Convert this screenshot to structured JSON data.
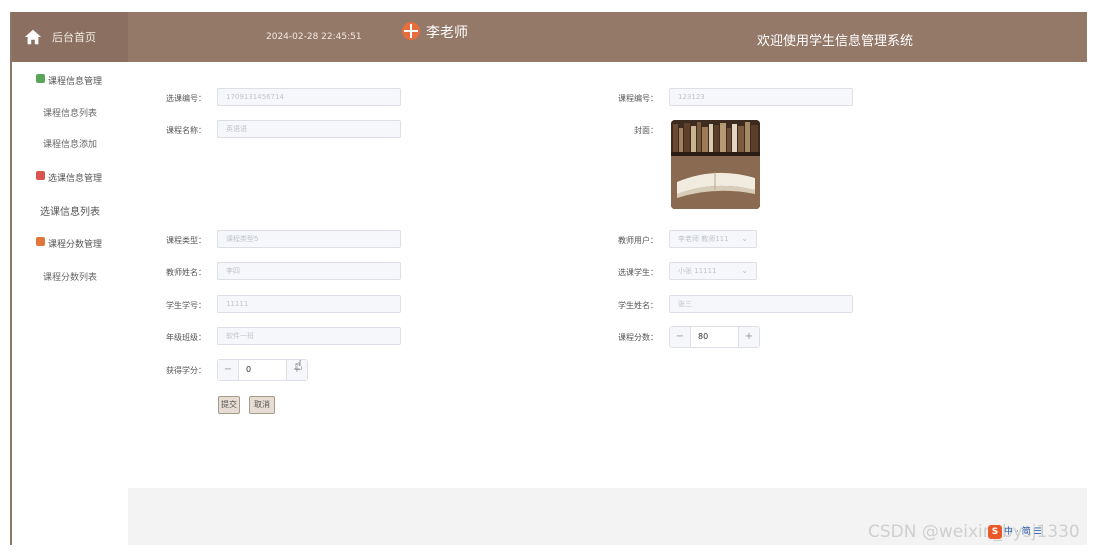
{
  "header": {
    "home_label": "后台首页",
    "datetime": "2024-02-28 22:45:51",
    "user_name": "李老师",
    "welcome": "欢迎使用学生信息管理系统"
  },
  "sidebar": {
    "groups": [
      {
        "label": "课程信息管理",
        "color": "#5ba55b"
      },
      {
        "label": "选课信息管理",
        "color": "#d9534f"
      },
      {
        "label": "课程分数管理",
        "color": "#e0763c"
      }
    ],
    "items": [
      "课程信息列表",
      "课程信息添加",
      "选课信息列表",
      "课程分数列表"
    ]
  },
  "form": {
    "xuanke_no_label": "选课编号：",
    "xuanke_no": "1709131456714",
    "course_no_label": "课程编号：",
    "course_no": "123123",
    "course_name_label": "课程名称：",
    "course_name": "英语语",
    "cover_label": "封面：",
    "course_type_label": "课程类型：",
    "course_type": "课程类型5",
    "teacher_user_label": "教师用户：",
    "teacher_user": "李老师 教师111",
    "teacher_name_label": "教师姓名：",
    "teacher_name": "李四",
    "student_label": "选课学生：",
    "student": "小张 11111",
    "student_no_label": "学生学号：",
    "student_no": "11111",
    "student_name_label": "学生姓名：",
    "student_name": "张三",
    "grade_label": "年级班级：",
    "grade": "软件一班",
    "score_label": "课程分数：",
    "score": "80",
    "credit_label": "获得学分：",
    "credit": "0",
    "submit": "提交",
    "cancel": "取消"
  },
  "watermark": "CSDN @weixin_bysj1330",
  "ime_text": "中 · 简 ☰"
}
